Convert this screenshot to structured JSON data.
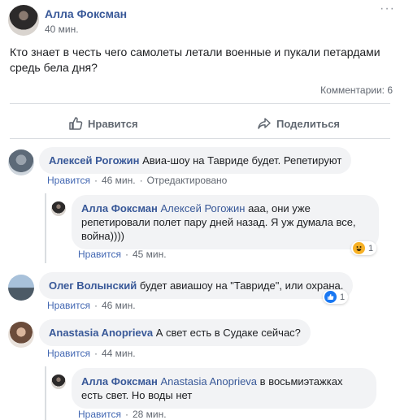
{
  "post": {
    "author": "Алла Фоксман",
    "time": "40 мин.",
    "text": "Кто знает в честь чего самолеты летали военные и пукали петардами средь бела дня?",
    "comments_label": "Комментарии: 6",
    "actions": {
      "like": "Нравится",
      "share": "Поделиться"
    }
  },
  "comments": [
    {
      "author": "Алексей Рогожин",
      "text": "Авиа-шоу на Тавриде будет. Репетируют",
      "like": "Нравится",
      "time": "46 мин.",
      "edited": "Отредактировано"
    },
    {
      "author": "Алла Фоксман",
      "mention": "Алексей Рогожин",
      "text": "ааа, они уже репетировали полет пару дней назад. Я уж думала все, война))))",
      "like": "Нравится",
      "time": "45 мин.",
      "reaction": {
        "icon": "haha-reaction-icon",
        "count": "1"
      }
    },
    {
      "author": "Олег Волынский",
      "text": "будет авиашоу на \"Тавриде\", или охрана.",
      "like": "Нравится",
      "time": "46 мин.",
      "reaction": {
        "icon": "like-reaction-icon",
        "count": "1"
      }
    },
    {
      "author": "Anastasia Anoprieva",
      "text": "А свет есть в Судаке сейчас?",
      "like": "Нравится",
      "time": "44 мин."
    },
    {
      "author": "Алла Фоксман",
      "mention": "Anastasia Anoprieva",
      "text": "в восьмиэтажках есть свет. Но воды нет",
      "like": "Нравится",
      "time": "28 мин."
    }
  ],
  "colors": {
    "link": "#385898",
    "bubble": "#f2f3f5",
    "meta": "#616770",
    "action_link": "#4267b2"
  }
}
